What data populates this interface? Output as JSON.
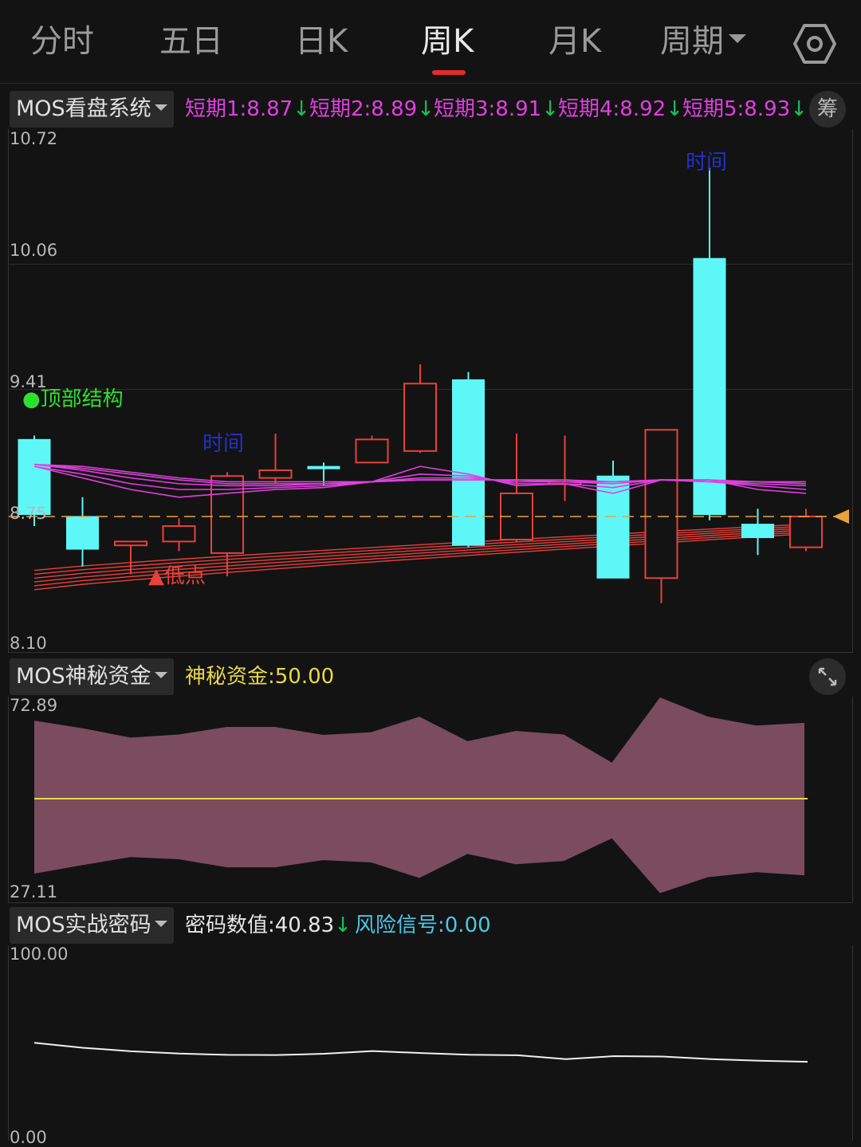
{
  "tabs": [
    {
      "label": "分时",
      "active": false
    },
    {
      "label": "五日",
      "active": false
    },
    {
      "label": "日K",
      "active": false
    },
    {
      "label": "周K",
      "active": true
    },
    {
      "label": "月K",
      "active": false
    },
    {
      "label": "周期",
      "active": false,
      "dropdown": true
    }
  ],
  "settings_icon": "settings-hexagon-icon",
  "panel1": {
    "selector": "MOS看盘系统",
    "legend": [
      {
        "label": "短期1:8.87",
        "color": "#e040e0",
        "arrow": "↓"
      },
      {
        "label": "短期2:8.89",
        "color": "#e040e0",
        "arrow": "↓"
      },
      {
        "label": "短期3:8.91",
        "color": "#e040e0",
        "arrow": "↓"
      },
      {
        "label": "短期4:8.92",
        "color": "#e040e0",
        "arrow": "↓"
      },
      {
        "label": "短期5:8.93",
        "color": "#e040e0",
        "arrow": "↓"
      }
    ],
    "chip_button": "筹",
    "y_labels": [
      "10.72",
      "10.06",
      "9.41",
      "8.75",
      "8.10"
    ],
    "annotations": {
      "top_structure": "●顶部结构",
      "time_1": "时间",
      "time_2": "时间",
      "low_point": "▲低点"
    },
    "colors": {
      "up": "#e8403a",
      "down": "#5ef7f7",
      "ma": "#e040e0",
      "low_band": "#e8403a",
      "current": "#e8a33a"
    }
  },
  "panel2": {
    "selector": "MOS神秘资金",
    "legend": {
      "label": "神秘资金:50.00",
      "color": "#e8d84a"
    },
    "expand_icon": "expand-arrows-icon",
    "y_labels": [
      "72.89",
      "27.11"
    ]
  },
  "panel3": {
    "selector": "MOS实战密码",
    "legend": [
      {
        "label": "密码数值:40.83",
        "color": "#e6e6e6",
        "arrow": "↓"
      },
      {
        "label": "风险信号:0.00",
        "color": "#4cc6e6",
        "arrow": ""
      }
    ],
    "y_labels": [
      "100.00",
      "0.00"
    ]
  },
  "chart_data": [
    {
      "type": "candlestick",
      "title": "MOS看盘系统",
      "ylim": [
        8.1,
        10.72
      ],
      "current_price": 8.75,
      "candles": [
        {
          "open": 9.15,
          "close": 8.76,
          "high": 9.17,
          "low": 8.7,
          "dir": "down"
        },
        {
          "open": 8.75,
          "close": 8.58,
          "high": 8.85,
          "low": 8.49,
          "dir": "down"
        },
        {
          "open": 8.6,
          "close": 8.62,
          "high": 8.62,
          "low": 8.45,
          "dir": "up"
        },
        {
          "open": 8.62,
          "close": 8.7,
          "high": 8.74,
          "low": 8.57,
          "dir": "up"
        },
        {
          "open": 8.56,
          "close": 8.96,
          "high": 8.98,
          "low": 8.44,
          "dir": "up"
        },
        {
          "open": 8.95,
          "close": 8.99,
          "high": 9.18,
          "low": 8.92,
          "dir": "up"
        },
        {
          "open": 9.01,
          "close": 9.0,
          "high": 9.03,
          "low": 8.91,
          "dir": "down"
        },
        {
          "open": 9.03,
          "close": 9.15,
          "high": 9.17,
          "low": 9.03,
          "dir": "up"
        },
        {
          "open": 9.09,
          "close": 9.44,
          "high": 9.54,
          "low": 9.08,
          "dir": "up"
        },
        {
          "open": 9.46,
          "close": 8.6,
          "high": 9.5,
          "low": 8.59,
          "dir": "down"
        },
        {
          "open": 8.63,
          "close": 8.87,
          "high": 9.18,
          "low": 8.62,
          "dir": "up"
        },
        {
          "open": 8.92,
          "close": 8.93,
          "high": 9.17,
          "low": 8.83,
          "dir": "up"
        },
        {
          "open": 8.96,
          "close": 8.43,
          "high": 9.04,
          "low": 8.43,
          "dir": "down"
        },
        {
          "open": 8.43,
          "close": 9.2,
          "high": 9.2,
          "low": 8.3,
          "dir": "up"
        },
        {
          "open": 10.09,
          "close": 8.76,
          "high": 10.56,
          "low": 8.73,
          "dir": "down"
        },
        {
          "open": 8.71,
          "close": 8.64,
          "high": 8.79,
          "low": 8.55,
          "dir": "down"
        },
        {
          "open": 8.59,
          "close": 8.75,
          "high": 8.79,
          "low": 8.57,
          "dir": "up"
        }
      ],
      "ma_series": [
        {
          "name": "短期1",
          "values": [
            9.01,
            8.95,
            8.89,
            8.85,
            8.87,
            8.89,
            8.9,
            8.93,
            9.01,
            8.97,
            8.91,
            8.92,
            8.87,
            8.94,
            8.94,
            8.89,
            8.87
          ]
        },
        {
          "name": "短期2",
          "values": [
            9.01,
            8.97,
            8.92,
            8.89,
            8.89,
            8.9,
            8.91,
            8.93,
            8.97,
            8.96,
            8.92,
            8.92,
            8.9,
            8.94,
            8.93,
            8.91,
            8.89
          ]
        },
        {
          "name": "短期3",
          "values": [
            9.02,
            8.99,
            8.95,
            8.92,
            8.91,
            8.91,
            8.92,
            8.93,
            8.95,
            8.95,
            8.93,
            8.93,
            8.92,
            8.94,
            8.93,
            8.92,
            8.91
          ]
        },
        {
          "name": "短期4",
          "values": [
            9.02,
            9.0,
            8.97,
            8.94,
            8.92,
            8.92,
            8.92,
            8.93,
            8.94,
            8.94,
            8.94,
            8.93,
            8.93,
            8.94,
            8.93,
            8.93,
            8.92
          ]
        },
        {
          "name": "短期5",
          "values": [
            9.02,
            9.01,
            8.98,
            8.95,
            8.93,
            8.93,
            8.93,
            8.93,
            8.94,
            8.94,
            8.94,
            8.94,
            8.93,
            8.94,
            8.94,
            8.93,
            8.93
          ]
        }
      ],
      "low_band": {
        "start": [
          8.47,
          8.45,
          8.43,
          8.41,
          8.39,
          8.37
        ],
        "end": [
          8.71,
          8.7,
          8.69,
          8.68,
          8.67,
          8.66
        ]
      }
    },
    {
      "type": "area",
      "title": "MOS神秘资金",
      "ylim": [
        27.11,
        72.89
      ],
      "midline": 50.0,
      "upper": [
        67.5,
        65.8,
        63.7,
        64.4,
        66.1,
        66.1,
        64.3,
        64.9,
        68.4,
        62.9,
        65.2,
        64.4,
        58.1,
        72.7,
        68.4,
        66.4,
        67.0
      ],
      "lower": [
        33.2,
        35.1,
        36.9,
        36.4,
        34.6,
        34.6,
        36.2,
        35.7,
        32.2,
        37.6,
        35.3,
        36.0,
        41.1,
        28.8,
        32.4,
        33.5,
        32.8
      ]
    },
    {
      "type": "line",
      "title": "MOS实战密码",
      "ylim": [
        0,
        100
      ],
      "series": [
        {
          "name": "密码数值",
          "values": [
            51.2,
            48.5,
            46.6,
            45.3,
            44.6,
            44.5,
            45.2,
            46.7,
            45.6,
            44.7,
            44.4,
            42.3,
            43.9,
            43.7,
            42.3,
            41.4,
            40.8
          ]
        }
      ]
    }
  ]
}
